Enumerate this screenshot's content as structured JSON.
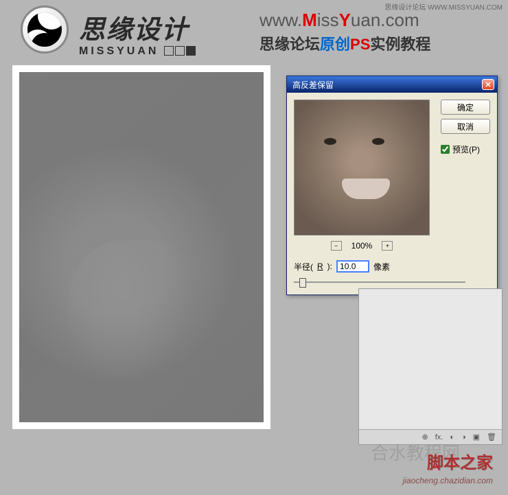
{
  "top_credit_prefix": "思缘设计论坛 ",
  "top_credit_url": "WWW.MISSYUAN.COM",
  "brand": {
    "cn": "思缘设计",
    "en": "MISSYUAN"
  },
  "url": {
    "prefix": "www.",
    "m": "M",
    "iss": "iss",
    "y": "Y",
    "uan": "uan.com"
  },
  "tagline": {
    "p1": "思缘论坛",
    "p2": "原创",
    "p3": "PS",
    "p4": "实例教程"
  },
  "dialog": {
    "title": "高反差保留",
    "ok": "确定",
    "cancel": "取消",
    "preview_label": "预览(P)",
    "zoom_value": "100%",
    "radius_label_pre": "半径(",
    "radius_label_u": "R",
    "radius_label_post": "):",
    "radius_value": "10.0",
    "radius_unit": "像素"
  },
  "layers_icons": [
    "⊕",
    "fx.",
    "◐",
    "◑",
    "▣",
    "🗑"
  ],
  "watermark": {
    "bg": "合水教程网",
    "main": "脚本之家",
    "url": "jiaocheng.chazidian.com"
  }
}
